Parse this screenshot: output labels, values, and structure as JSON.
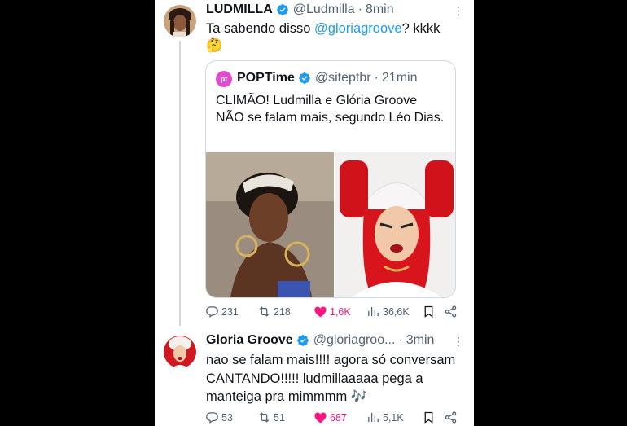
{
  "tweets": [
    {
      "name": "LUDMILLA",
      "handle": "@Ludmilla",
      "time": "8min",
      "text_prefix": "Ta sabendo disso ",
      "mention": "@gloriagroove",
      "text_suffix": "? kkkk",
      "emoji": "🤔",
      "quote": {
        "name": "POPTime",
        "handle": "@siteptbr",
        "time": "21min",
        "avatar_text": "pt",
        "text": "CLIMÃO! Ludmilla e Glória Groove NÃO se falam mais, segundo Léo Dias."
      },
      "actions": {
        "replies": "231",
        "retweets": "218",
        "likes": "1,6K",
        "views": "36,6K"
      }
    },
    {
      "name": "Gloria Groove",
      "handle": "@gloriagroo...",
      "time": "3min",
      "text": "nao se falam mais!!!! agora só conversam CANTANDO!!!!! ludmillaaaaa pega a manteiga pra mimmmm",
      "emoji": "🎶",
      "actions": {
        "replies": "53",
        "retweets": "51",
        "likes": "687",
        "views": "5,1K"
      }
    }
  ],
  "colors": {
    "accent": "#1d9bf0",
    "like": "#f91880",
    "muted": "#536471",
    "border": "#cfd9de"
  }
}
